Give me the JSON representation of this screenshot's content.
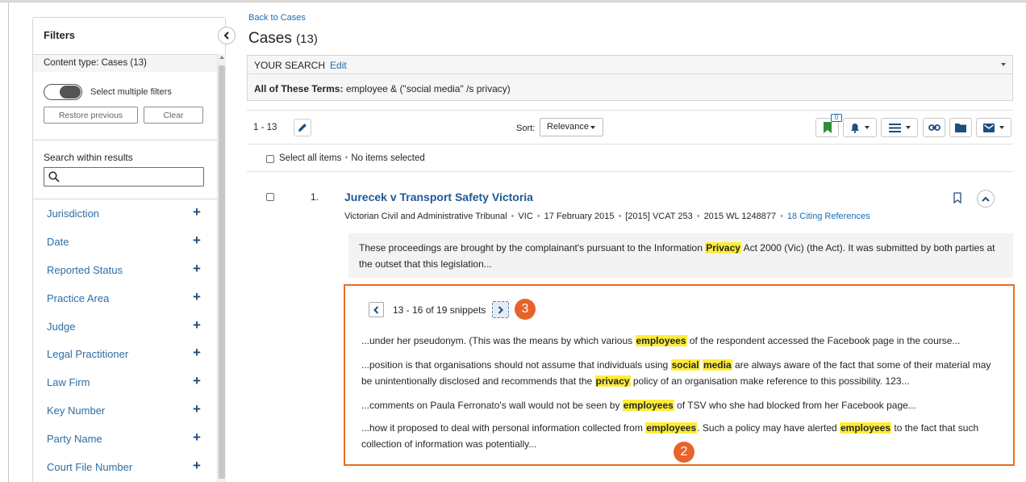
{
  "sidebar": {
    "title": "Filters",
    "content_type": "Content type: Cases (13)",
    "toggle_label": "Select multiple filters",
    "restore_label": "Restore previous",
    "clear_label": "Clear",
    "search_within_label": "Search within results",
    "search_within_value": "",
    "facets": [
      {
        "label": "Jurisdiction"
      },
      {
        "label": "Date"
      },
      {
        "label": "Reported Status"
      },
      {
        "label": "Practice Area"
      },
      {
        "label": "Judge"
      },
      {
        "label": "Legal Practitioner"
      },
      {
        "label": "Law Firm"
      },
      {
        "label": "Key Number"
      },
      {
        "label": "Party Name"
      },
      {
        "label": "Court File Number"
      }
    ],
    "plus": "+"
  },
  "header": {
    "back_link": "Back to Cases",
    "title": "Cases",
    "count": "(13)"
  },
  "search": {
    "label": "YOUR SEARCH",
    "edit": "Edit",
    "terms_label": "All of These Terms:",
    "terms_value": "employee & (\"social media\" /s privacy)"
  },
  "toolbar": {
    "range": "1 - 13",
    "sort_label": "Sort:",
    "sort_value": "Relevance",
    "folder_badge": "0",
    "select_all": "Select all items",
    "no_selected": "No items selected"
  },
  "result": {
    "number": "1.",
    "title": "Jurecek v Transport Safety Victoria",
    "meta": {
      "court": "Victorian Civil and Administrative Tribunal",
      "jurisdiction": "VIC",
      "date": "17 February 2015",
      "citation": "[2015] VCAT 253",
      "wl": "2015 WL 1248877",
      "citing": "18 Citing References"
    },
    "summary_before": "These proceedings are brought by the complainant's pursuant to the Information ",
    "summary_mark": "Privacy",
    "summary_after": " Act 2000 (Vic) (the Act). It was submitted by both parties at the outset that this legislation..."
  },
  "snippets": {
    "count": "13 - 16 of 19 snippets",
    "callout_next": "3",
    "callout_body": "2",
    "s1_a": "...under her pseudonym. (This was the means by which various ",
    "s1_m": "employees",
    "s1_b": " of the respondent accessed the Facebook page in the course...",
    "s2_a": "...position is that organisations should not assume that individuals using ",
    "s2_m1": "social",
    "s2_m2": "media",
    "s2_b": " are always aware of the fact that some of their material may be unintentionally disclosed and recommends that the ",
    "s2_m3": "privacy",
    "s2_c": " policy of an organisation make reference to this possibility. 123...",
    "s3_a": "...comments on Paula Ferronato's wall would not be seen by ",
    "s3_m": "employees",
    "s3_b": " of TSV who she had blocked from her Facebook page...",
    "s4_a": "...how it proposed to deal with personal information collected from ",
    "s4_m1": "employees",
    "s4_b": ". Such a policy may have alerted ",
    "s4_m2": "employees",
    "s4_c": " to the fact that such collection of information was potentially..."
  },
  "colors": {
    "link": "#1a6bb4",
    "highlight": "#ffed3a",
    "callout": "#e8632a",
    "snippet_border": "#ea6c22",
    "flag_green": "#2e8b3a"
  }
}
